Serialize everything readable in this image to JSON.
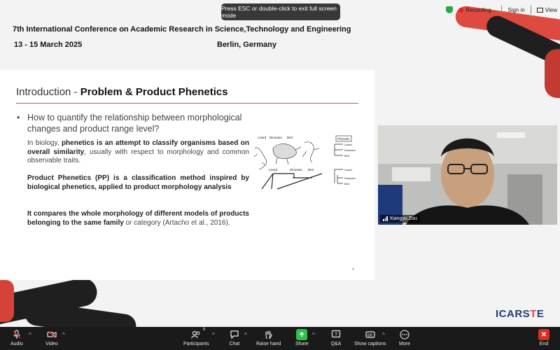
{
  "overlay": {
    "esc_hint": "Press ESC or double-click to exit full screen mode",
    "recording_label": "Recording...",
    "signin_label": "Sign in",
    "view_label": "View"
  },
  "conference": {
    "title": "7th International Conference on Academic Research in Science,Technology and Engineering",
    "dates": "13 - 15 March 2025",
    "location": "Berlin, Germany"
  },
  "slide": {
    "title_prefix": "Introduction - ",
    "title_bold": "Problem & Product Phenetics",
    "bullet": "•",
    "question_line1": "How to quantify the relationship between morphological",
    "question_line2": "changes and product range level?",
    "p1_a": "In biology, ",
    "p1_b": "phenetics is an attempt to classify organisms based on overall similarity",
    "p1_c": ", usually with respect to morphology and common observable traits.",
    "p2_b": "Product Phenetics (PP) is a classification method inspired by biological phenetics, applied to product morphology analysis",
    "p3_b": "It compares the whole morphology of different models of products belonging to the same family",
    "p3_c": " or category (Artacho et al., 2016).",
    "page_number": "4",
    "figure": {
      "top_labels": [
        "Lizard",
        "Dinosaur",
        "Bird"
      ],
      "bottom_labels": [
        "Lizard",
        "Dinosaur",
        "Bird"
      ],
      "phenetic_title": "Phenetic",
      "phenetic_labels": [
        "Lizard",
        "Dinosaur",
        "Bird"
      ],
      "phenetic_labels2": [
        "Lizard",
        "Dinosaur",
        "Bird"
      ]
    }
  },
  "video": {
    "participant_name": "Xiangyu Zou"
  },
  "logo": {
    "part1": "ICARS",
    "part2": "T",
    "part3": "E"
  },
  "toolbar": {
    "audio": "Audio",
    "video": "Video",
    "participants": "Participants",
    "participants_count": "8",
    "chat": "Chat",
    "raise_hand": "Raise hand",
    "share": "Share",
    "qa": "Q&A",
    "captions": "Show captions",
    "more": "More",
    "end": "End"
  },
  "colors": {
    "accent_red": "#de4a3f",
    "toolbar_bg": "#1a1a1a",
    "share_green": "#2fbf4a",
    "end_red": "#d92d20"
  }
}
